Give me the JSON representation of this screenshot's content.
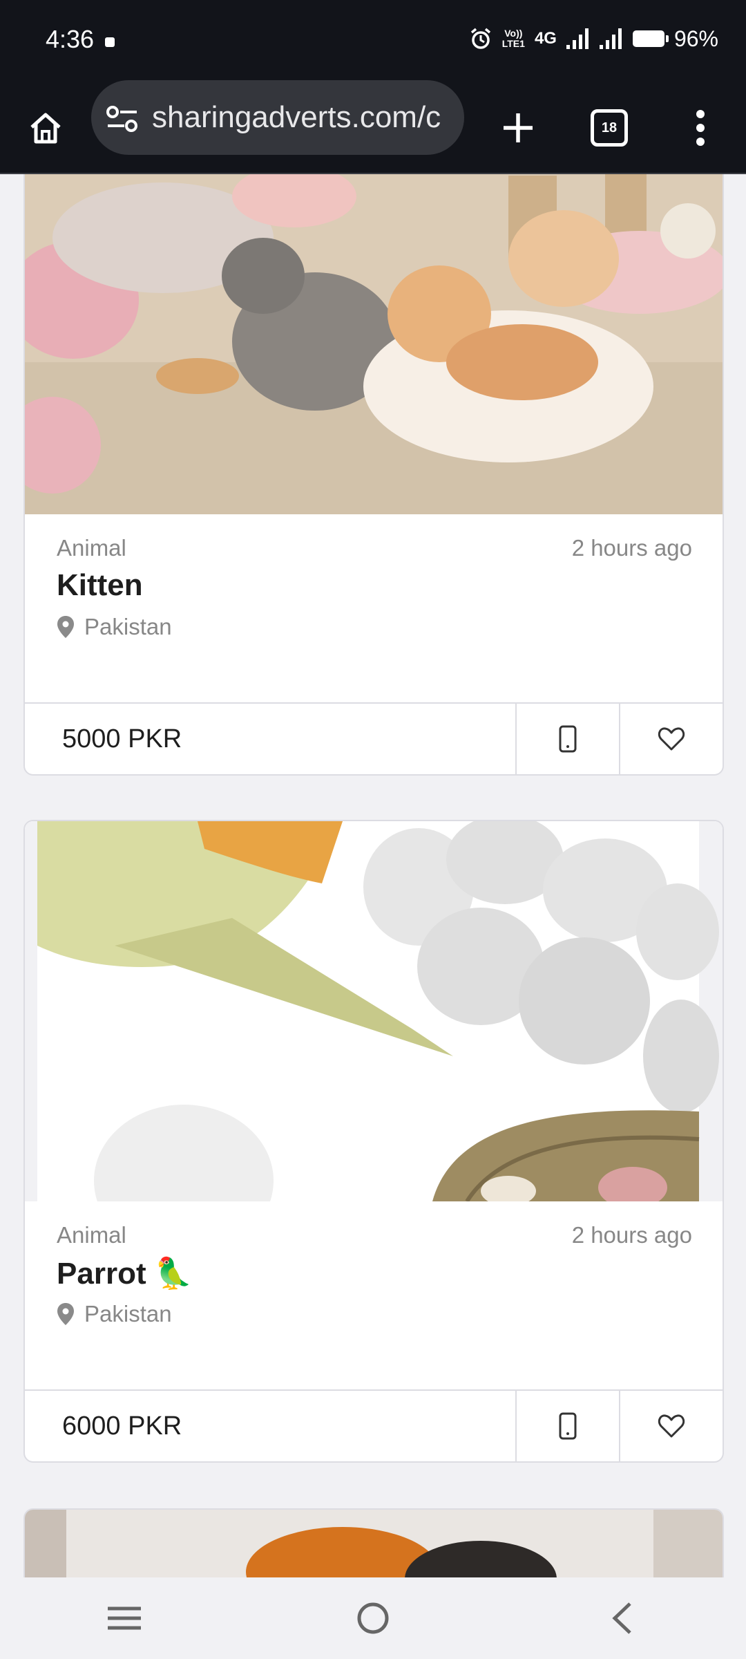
{
  "status_bar": {
    "time": "4:36",
    "volte_line1": "Vo))",
    "volte_line2": "LTE1",
    "network": "4G",
    "battery": "96%"
  },
  "browser": {
    "url": "sharingadverts.com/c",
    "tab_count": "18",
    "icons": [
      "home-icon",
      "site-settings-icon",
      "new-tab-icon",
      "tab-switcher-icon",
      "more-options-icon"
    ]
  },
  "listings": [
    {
      "category": "Animal",
      "time_ago": "2 hours ago",
      "title": "Kitten",
      "location": "Pakistan",
      "price": "5000 PKR"
    },
    {
      "category": "Animal",
      "time_ago": "2 hours ago",
      "title": "Parrot 🦜",
      "location": "Pakistan",
      "price": "6000 PKR"
    }
  ],
  "nav": {
    "icons": [
      "recents-icon",
      "home-circle-icon",
      "back-icon"
    ]
  },
  "colors": {
    "status_bg": "#12141a",
    "page_bg": "#f1f1f4",
    "muted_text": "#878787",
    "border": "#dcdce2"
  }
}
